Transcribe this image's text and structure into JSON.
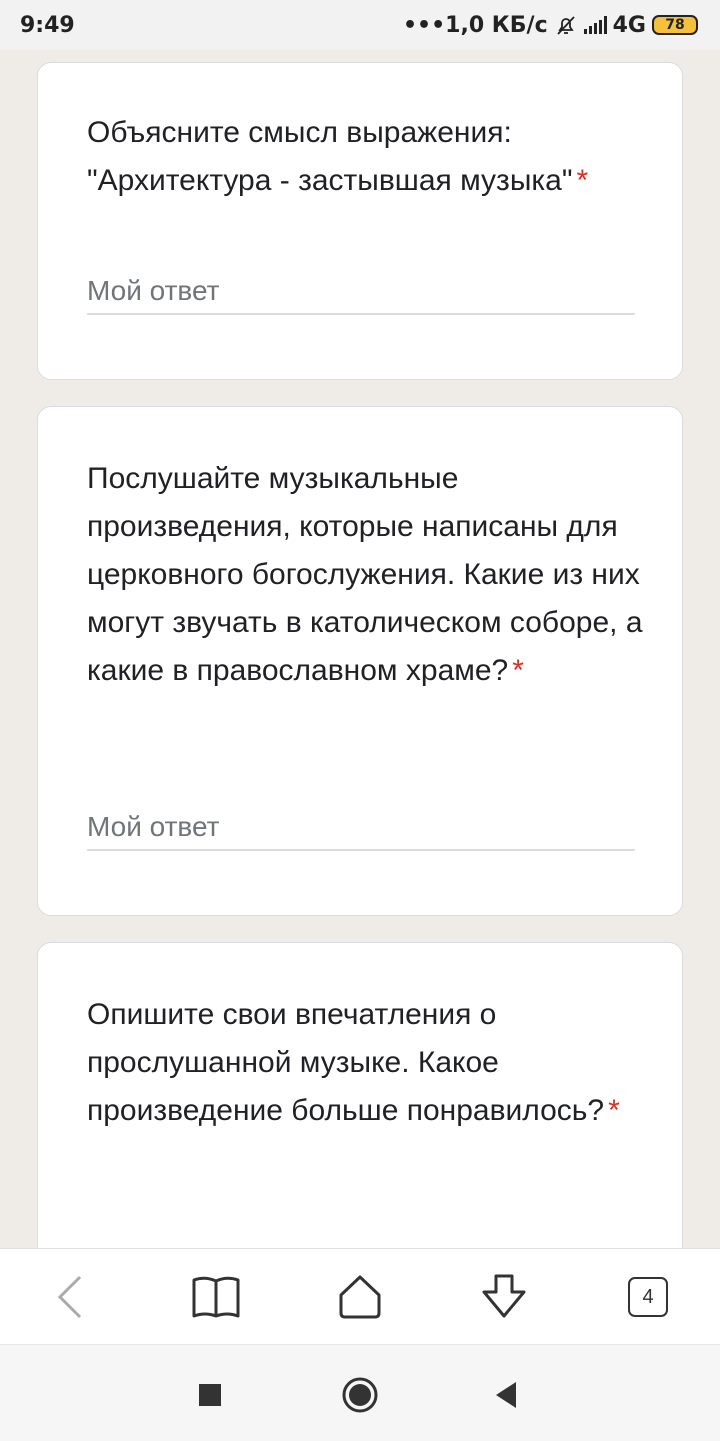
{
  "status_bar": {
    "time": "9:49",
    "network_speed": "•••1,0 КБ/с",
    "network_type": "4G",
    "battery": "78",
    "icons": [
      "mute-bell-icon",
      "signal-icon",
      "battery-icon"
    ]
  },
  "questions": [
    {
      "text": "Объясните смысл выражения: \"Архитектура - застывшая музыка\"",
      "required_mark": "*",
      "placeholder": "Мой ответ"
    },
    {
      "text": "Послушайте музыкальные произведения, которые написаны для церковного богослужения. Какие из них могут звучать в католическом соборе, а какие в православном храме?",
      "required_mark": "*",
      "placeholder": "Мой ответ"
    },
    {
      "text": "Опишите свои впечатления о прослушанной музыке. Какое произведение больше понравилось?",
      "required_mark": "*"
    }
  ],
  "browser_toolbar": {
    "tab_count": "4",
    "icons": [
      "back-icon",
      "bookmarks-icon",
      "home-icon",
      "download-icon",
      "tabs-icon"
    ]
  },
  "system_nav": {
    "icons": [
      "recents-icon",
      "home-circle-icon",
      "back-triangle-icon"
    ]
  },
  "colors": {
    "background": "#efebe6",
    "required": "#d93025",
    "placeholder": "#70757a"
  }
}
